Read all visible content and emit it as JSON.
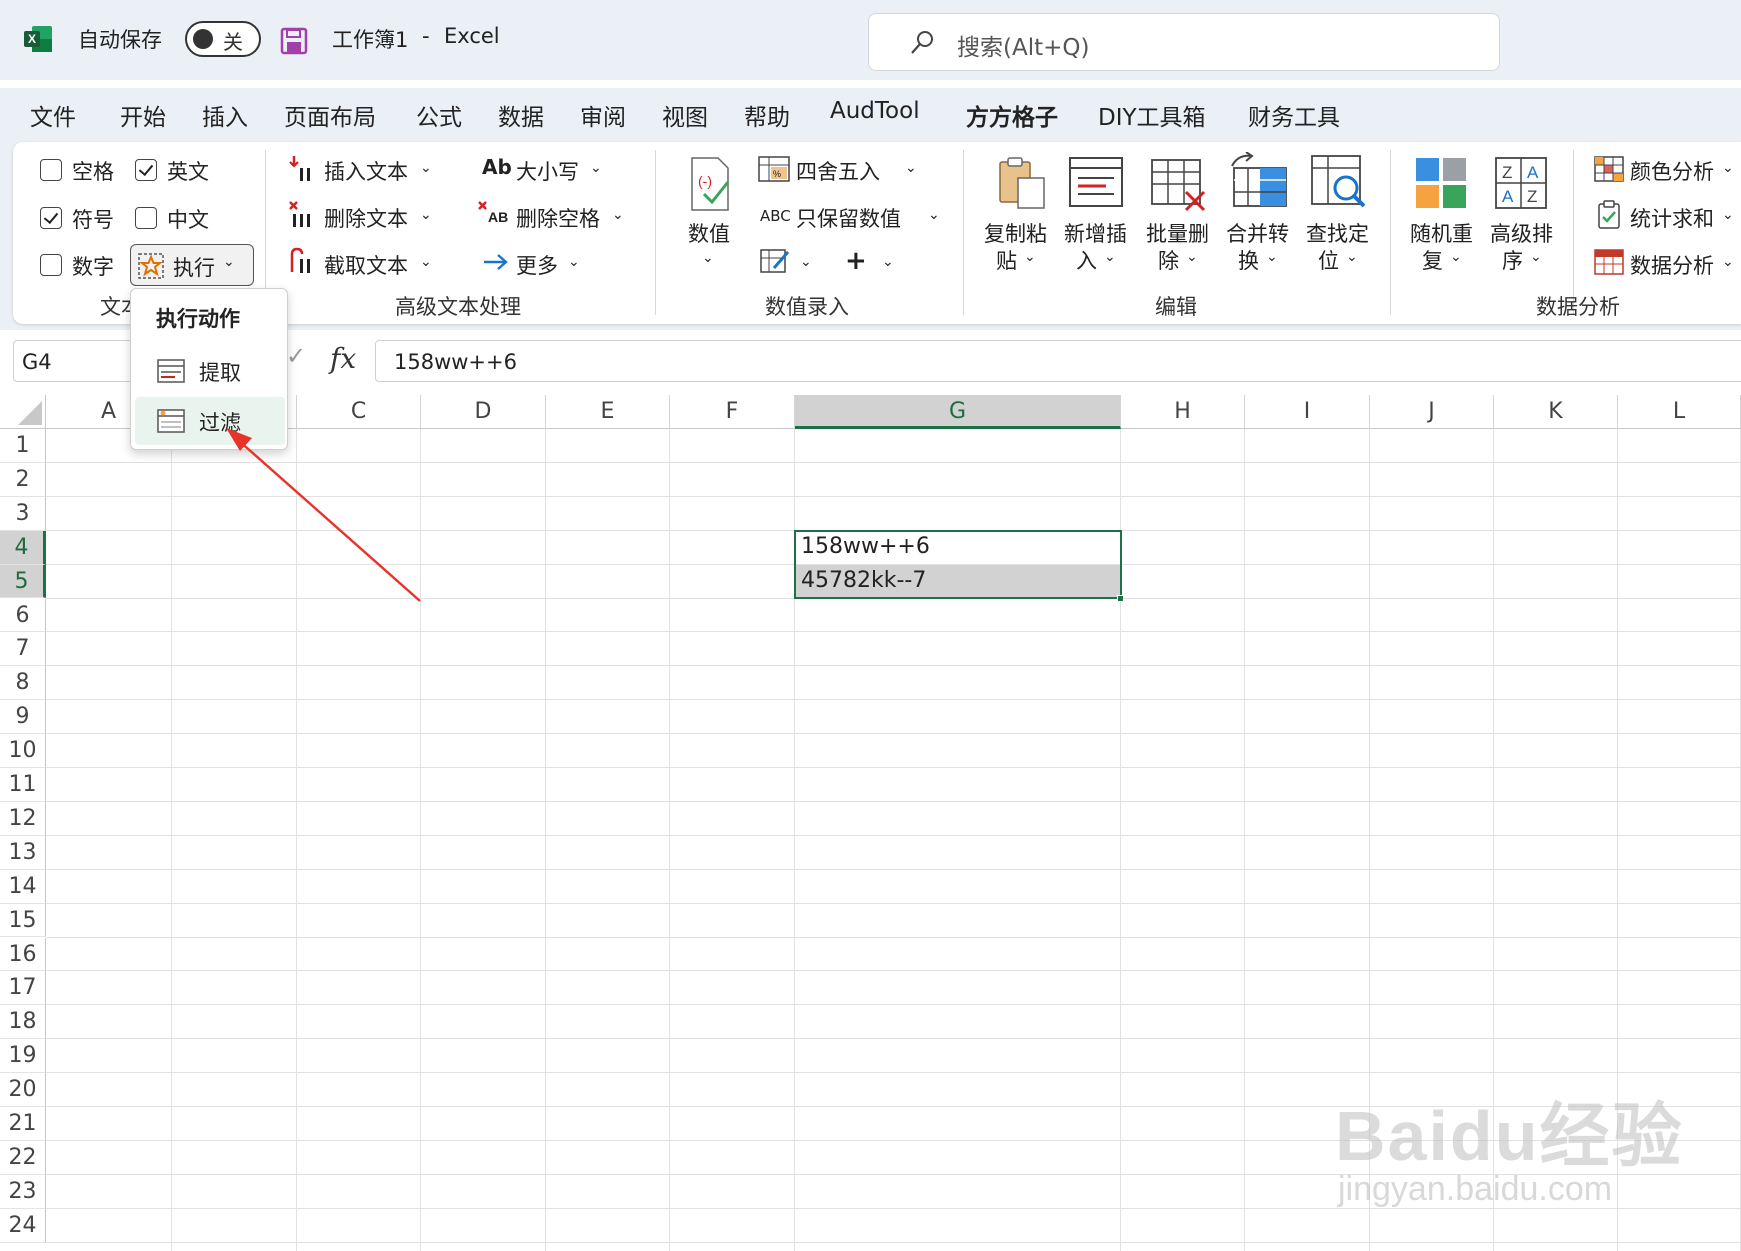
{
  "titlebar": {
    "autosave_label": "自动保存",
    "autosave_state": "关",
    "workbook": "工作簿1",
    "separator": "-",
    "app": "Excel",
    "search_placeholder": "搜索(Alt+Q)"
  },
  "tabs": [
    "文件",
    "开始",
    "插入",
    "页面布局",
    "公式",
    "数据",
    "审阅",
    "视图",
    "帮助",
    "AudTool",
    "方方格子",
    "DIY工具箱",
    "财务工具"
  ],
  "active_tab": "方方格子",
  "ribbon": {
    "text_group": {
      "checkboxes": [
        {
          "label": "空格",
          "checked": false
        },
        {
          "label": "英文",
          "checked": true
        },
        {
          "label": "符号",
          "checked": true
        },
        {
          "label": "中文",
          "checked": false
        },
        {
          "label": "数字",
          "checked": false
        }
      ],
      "exec_label": "执行",
      "group_label": "文本"
    },
    "advanced_text": {
      "insert": "插入文本",
      "delete": "删除文本",
      "extract": "截取文本",
      "case": "大小写",
      "delete_space": "删除空格",
      "more": "更多",
      "group_label": "高级文本处理"
    },
    "numeric": {
      "value_btn": "数值",
      "round": "四舍五入",
      "keep_value": "只保留数值",
      "group_label": "数值录入"
    },
    "edit": {
      "copy_paste": [
        "复制粘",
        "贴"
      ],
      "new_insert": [
        "新增插",
        "入"
      ],
      "batch_delete": [
        "批量删",
        "除"
      ],
      "merge_convert": [
        "合并转",
        "换"
      ],
      "find_locate": [
        "查找定",
        "位"
      ],
      "group_label": "编辑"
    },
    "analysis": {
      "random": [
        "随机重",
        "复"
      ],
      "sort": [
        "高级排",
        "序"
      ],
      "color_analysis": "颜色分析",
      "stat_sum": "统计求和",
      "data_analysis": "数据分析",
      "group_label": "数据分析"
    }
  },
  "formula_bar": {
    "name_box": "G4",
    "fx": "fx",
    "formula": "158ww++6"
  },
  "columns": [
    "A",
    "B",
    "C",
    "D",
    "E",
    "F",
    "G",
    "H",
    "I",
    "J",
    "K",
    "L"
  ],
  "selected_column": "G",
  "rows": [
    "1",
    "2",
    "3",
    "4",
    "5",
    "6",
    "7",
    "8",
    "9",
    "10",
    "11",
    "12",
    "13",
    "14",
    "15",
    "16",
    "17",
    "18",
    "19",
    "20",
    "21",
    "22",
    "23",
    "24"
  ],
  "selected_rows": [
    "4",
    "5"
  ],
  "cells": {
    "G4": "158ww++6",
    "G5": "45782kk--7"
  },
  "dropdown": {
    "title": "执行动作",
    "items": [
      "提取",
      "过滤"
    ],
    "hovered": "过滤"
  },
  "watermark": {
    "main": "Baidu经验",
    "sub": "jingyan.baidu.com"
  }
}
